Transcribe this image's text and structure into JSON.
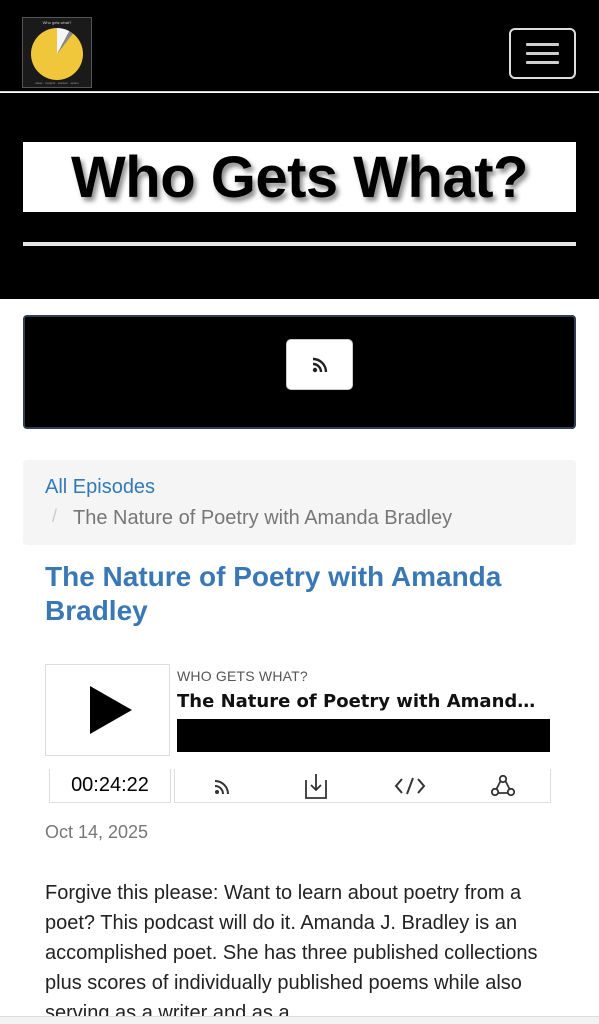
{
  "header": {
    "logo_text_top": "Who gets what?",
    "logo_text_bottom": "ideas · insights · wisdom · action",
    "menu_icon": "hamburger-menu-icon"
  },
  "hero": {
    "title": "Who Gets What?"
  },
  "rss": {
    "icon": "rss-icon"
  },
  "breadcrumb": {
    "link": "All Episodes",
    "separator": "/",
    "current": "The Nature of Poetry with Amanda Bradley"
  },
  "episode": {
    "title": "The Nature of Poetry with Amanda Bradley",
    "date": "Oct 14, 2025",
    "description": "Forgive this please:  Want to learn about poetry from a poet?  This podcast will do it.  Amanda J. Bradley is an accomplished poet.  She has three published collections plus scores of individually published poems while also serving as a writer and as a"
  },
  "player": {
    "show_name": "WHO GETS WHAT?",
    "episode_title": "The Nature of Poetry with Amanda ...",
    "duration": "00:24:22",
    "controls": [
      "rss-icon",
      "download-icon",
      "embed-code-icon",
      "share-icon"
    ]
  },
  "colors": {
    "link": "#337ab7",
    "title": "#3a78b5",
    "muted": "#777777",
    "background_dark": "#000000"
  }
}
